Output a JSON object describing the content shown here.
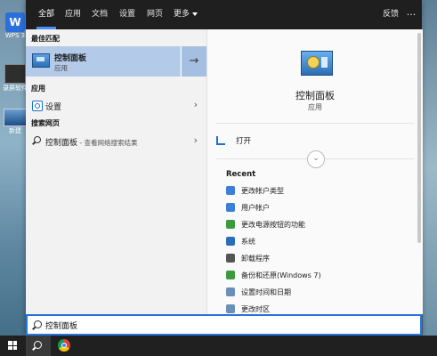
{
  "desktop": {
    "icons": [
      {
        "label": "WPS 3",
        "tile": "W"
      },
      {
        "label": "录屏软件"
      },
      {
        "label": "新建"
      }
    ]
  },
  "tabs": [
    {
      "label": "全部",
      "active": true
    },
    {
      "label": "应用"
    },
    {
      "label": "文档"
    },
    {
      "label": "设置"
    },
    {
      "label": "网页"
    },
    {
      "label": "更多"
    }
  ],
  "topbar": {
    "feedback": "反馈",
    "more": "···"
  },
  "left": {
    "best_match_heading": "最佳匹配",
    "best_match": {
      "title": "控制面板",
      "subtitle": "应用",
      "icon": "control-panel-icon",
      "arrow": "→"
    },
    "apps_heading": "应用",
    "apps": [
      {
        "label": "设置",
        "icon": "settings-icon",
        "chevron": "›"
      }
    ],
    "web_heading": "搜索网页",
    "web": [
      {
        "label": "控制面板",
        "sub": " - 查看网络搜索结果",
        "icon": "search-icon",
        "chevron": "›"
      }
    ]
  },
  "right": {
    "title": "控制面板",
    "subtitle": "应用",
    "open_label": "打开",
    "expand": "⌄",
    "recent_heading": "Recent",
    "recent": [
      {
        "label": "更改帐户类型",
        "color": "#3b7fd6"
      },
      {
        "label": "用户帐户",
        "color": "#3b7fd6"
      },
      {
        "label": "更改电源按钮的功能",
        "color": "#3c9a3c"
      },
      {
        "label": "系统",
        "color": "#2a6fb6"
      },
      {
        "label": "卸载程序",
        "color": "#555555"
      },
      {
        "label": "备份和还原(Windows 7)",
        "color": "#3c9a3c"
      },
      {
        "label": "设置时间和日期",
        "color": "#6b8fb8"
      },
      {
        "label": "更改时区",
        "color": "#6b8fb8"
      }
    ]
  },
  "search": {
    "value": "控制面板"
  },
  "colors": {
    "accent": "#2a73d9",
    "highlight": "#b3cbe8",
    "taskbar": "#202020"
  }
}
